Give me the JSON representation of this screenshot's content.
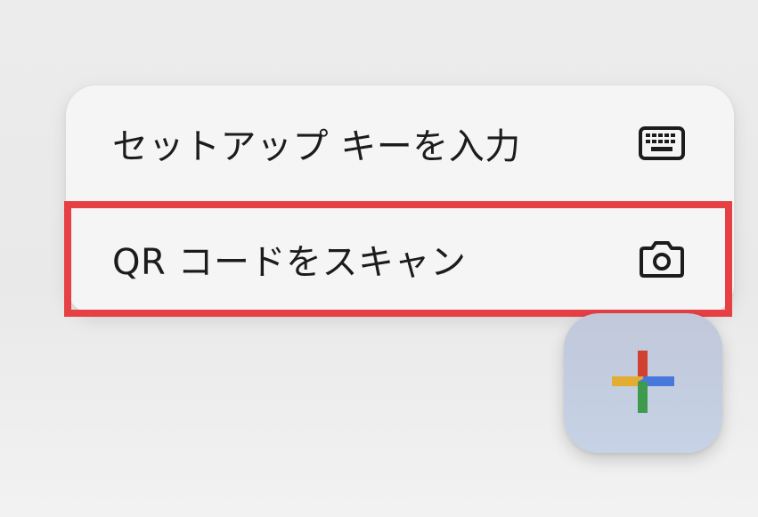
{
  "menu": {
    "items": [
      {
        "label": "セットアップ キーを入力",
        "icon": "keyboard-icon"
      },
      {
        "label": "QR コードをスキャン",
        "icon": "camera-icon",
        "highlighted": true
      }
    ]
  },
  "fab": {
    "icon": "google-plus-icon"
  },
  "colors": {
    "highlight_border": "#e64045",
    "menu_background": "#f5f5f5",
    "fab_background": "#c4cde0",
    "plus_red": "#d0412f",
    "plus_yellow": "#e3ad32",
    "plus_blue": "#4878dc",
    "plus_green": "#3e9b4d"
  }
}
